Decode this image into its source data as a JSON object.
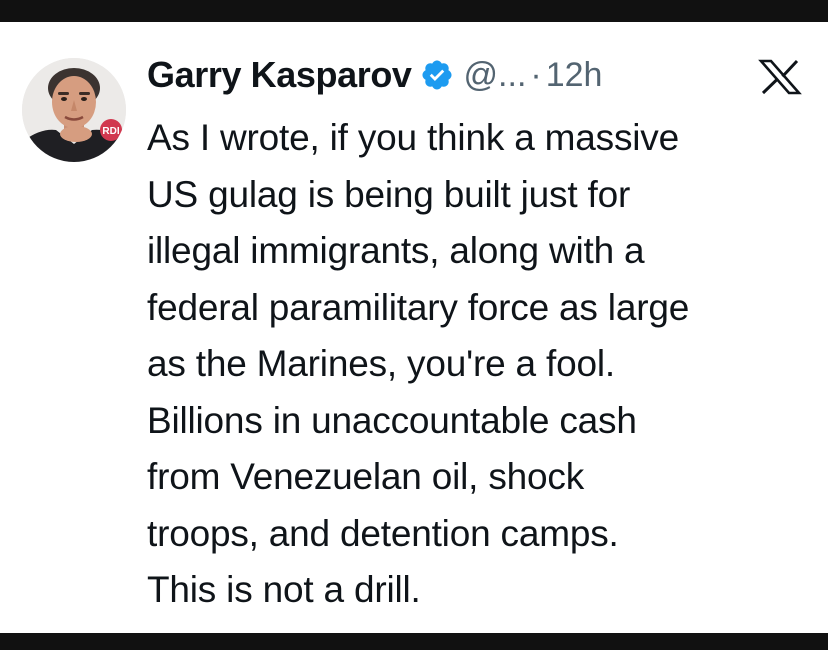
{
  "author": {
    "display_name": "Garry Kasparov",
    "handle": "@...",
    "separator": "·",
    "timestamp": "12h",
    "verified": true,
    "avatar_badge": "RDI",
    "verified_color": "#1d9bf0"
  },
  "platform": {
    "logo_icon": "x-logo-icon"
  },
  "tweet": {
    "lines": [
      "As I wrote, if you think a massive",
      "US gulag is being built just for",
      "illegal immigrants, along with a",
      "federal paramilitary force as large",
      "as the Marines, you're a fool.",
      "Billions in unaccountable cash",
      "from Venezuelan oil, shock",
      "troops, and detention camps.",
      "This is not a drill."
    ]
  }
}
